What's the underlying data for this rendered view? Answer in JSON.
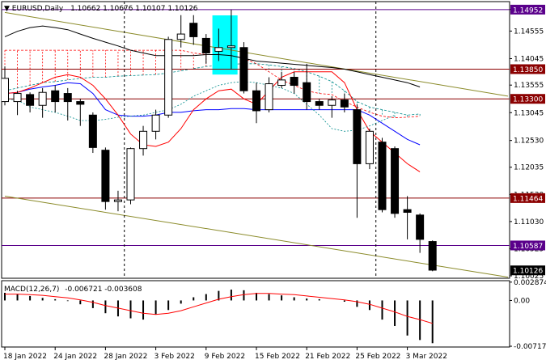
{
  "header": {
    "symbol": "EURUSD,Daily",
    "ohlc": "1.10662 1.10676 1.10107 1.10126"
  },
  "macd_header": {
    "label": "MACD(12,26,7)",
    "values": "-0.006721 -0.003608"
  },
  "colors": {
    "up_candle": "#ffffff",
    "down_candle": "#000000",
    "ma_red": "#ff0000",
    "ma_blue": "#0000ff",
    "ma_black": "#000000",
    "trend_olive": "#8b8b2a",
    "level_dark_red": "#8b0000",
    "level_purple": "#5a008b",
    "highlight_cyan": "#00ffff",
    "cloud_red": "#ff0000",
    "cloud_teal": "#008b8b",
    "current_price": "#000000",
    "macd_signal": "#ff0000"
  },
  "chart_data": [
    {
      "type": "candlestick",
      "symbol": "EURUSD",
      "timeframe": "Daily",
      "y_axis": {
        "ticks": [
          "1.14955",
          "1.14555",
          "1.14045",
          "1.13555",
          "1.13045",
          "1.12530",
          "1.12035",
          "1.11530",
          "1.11030",
          "1.10525",
          "1.10025"
        ],
        "ylim": [
          1.0998,
          1.151
        ]
      },
      "x_axis": {
        "ticks": [
          "18 Jan 2022",
          "24 Jan 2022",
          "28 Jan 2022",
          "3 Feb 2022",
          "9 Feb 2022",
          "15 Feb 2022",
          "21 Feb 2022",
          "25 Feb 2022",
          "3 Mar 2022"
        ],
        "tick_index": [
          0,
          4,
          8,
          12,
          16,
          20,
          24,
          28,
          32
        ]
      },
      "price_levels": [
        {
          "label": "1.14952",
          "value": 1.14952,
          "color": "#5a008b"
        },
        {
          "label": "1.13850",
          "value": 1.1385,
          "color": "#8b0000"
        },
        {
          "label": "1.13300",
          "value": 1.133,
          "color": "#8b0000"
        },
        {
          "label": "1.11464",
          "value": 1.11464,
          "color": "#8b0000"
        },
        {
          "label": "1.10587",
          "value": 1.10587,
          "color": "#5a008b"
        },
        {
          "label": "1.10126",
          "value": 1.10126,
          "color": "#000000"
        }
      ],
      "candles": [
        {
          "o": 1.1325,
          "h": 1.139,
          "l": 1.1318,
          "c": 1.1368
        },
        {
          "o": 1.1325,
          "h": 1.1345,
          "l": 1.13,
          "c": 1.134
        },
        {
          "o": 1.1338,
          "h": 1.1342,
          "l": 1.1305,
          "c": 1.1318
        },
        {
          "o": 1.1318,
          "h": 1.135,
          "l": 1.1295,
          "c": 1.1342
        },
        {
          "o": 1.1345,
          "h": 1.1355,
          "l": 1.1305,
          "c": 1.1325
        },
        {
          "o": 1.134,
          "h": 1.135,
          "l": 1.129,
          "c": 1.1325
        },
        {
          "o": 1.1325,
          "h": 1.133,
          "l": 1.128,
          "c": 1.132
        },
        {
          "o": 1.13,
          "h": 1.1305,
          "l": 1.123,
          "c": 1.124
        },
        {
          "o": 1.1235,
          "h": 1.124,
          "l": 1.1125,
          "c": 1.114
        },
        {
          "o": 1.114,
          "h": 1.116,
          "l": 1.1122,
          "c": 1.1143
        },
        {
          "o": 1.1143,
          "h": 1.124,
          "l": 1.1135,
          "c": 1.1238
        },
        {
          "o": 1.1238,
          "h": 1.128,
          "l": 1.1225,
          "c": 1.127
        },
        {
          "o": 1.127,
          "h": 1.131,
          "l": 1.1255,
          "c": 1.13
        },
        {
          "o": 1.13,
          "h": 1.1445,
          "l": 1.1295,
          "c": 1.144
        },
        {
          "o": 1.144,
          "h": 1.1485,
          "l": 1.1425,
          "c": 1.145
        },
        {
          "o": 1.147,
          "h": 1.1485,
          "l": 1.143,
          "c": 1.1445
        },
        {
          "o": 1.1442,
          "h": 1.145,
          "l": 1.1395,
          "c": 1.1415
        },
        {
          "o": 1.1418,
          "h": 1.146,
          "l": 1.14,
          "c": 1.1425
        },
        {
          "o": 1.1425,
          "h": 1.1495,
          "l": 1.1385,
          "c": 1.1428
        },
        {
          "o": 1.1425,
          "h": 1.1435,
          "l": 1.134,
          "c": 1.1345
        },
        {
          "o": 1.1345,
          "h": 1.136,
          "l": 1.1285,
          "c": 1.1308
        },
        {
          "o": 1.131,
          "h": 1.137,
          "l": 1.1305,
          "c": 1.1358
        },
        {
          "o": 1.1355,
          "h": 1.138,
          "l": 1.135,
          "c": 1.1365
        },
        {
          "o": 1.137,
          "h": 1.138,
          "l": 1.134,
          "c": 1.1355
        },
        {
          "o": 1.136,
          "h": 1.1395,
          "l": 1.131,
          "c": 1.1325
        },
        {
          "o": 1.1325,
          "h": 1.133,
          "l": 1.131,
          "c": 1.1318
        },
        {
          "o": 1.1318,
          "h": 1.1335,
          "l": 1.1295,
          "c": 1.1328
        },
        {
          "o": 1.1328,
          "h": 1.134,
          "l": 1.1305,
          "c": 1.1315
        },
        {
          "o": 1.131,
          "h": 1.132,
          "l": 1.111,
          "c": 1.121
        },
        {
          "o": 1.121,
          "h": 1.1275,
          "l": 1.12,
          "c": 1.127
        },
        {
          "o": 1.125,
          "h": 1.1258,
          "l": 1.112,
          "c": 1.1125
        },
        {
          "o": 1.1238,
          "h": 1.1242,
          "l": 1.111,
          "c": 1.1118
        },
        {
          "o": 1.1125,
          "h": 1.115,
          "l": 1.107,
          "c": 1.112
        },
        {
          "o": 1.1115,
          "h": 1.1118,
          "l": 1.1045,
          "c": 1.107
        },
        {
          "o": 1.1066,
          "h": 1.1068,
          "l": 1.1011,
          "c": 1.1013
        }
      ],
      "ma_red": [
        1.134,
        1.1342,
        1.135,
        1.136,
        1.137,
        1.1375,
        1.137,
        1.1355,
        1.133,
        1.13,
        1.1265,
        1.1245,
        1.1242,
        1.125,
        1.1275,
        1.131,
        1.133,
        1.1345,
        1.1348,
        1.133,
        1.132,
        1.1345,
        1.137,
        1.138,
        1.138,
        1.138,
        1.138,
        1.136,
        1.131,
        1.127,
        1.125,
        1.123,
        1.121,
        1.1195
      ],
      "ma_blue": [
        1.134,
        1.1342,
        1.1348,
        1.1352,
        1.1355,
        1.136,
        1.1358,
        1.134,
        1.131,
        1.13,
        1.1298,
        1.1298,
        1.13,
        1.1305,
        1.1305,
        1.1308,
        1.131,
        1.131,
        1.1312,
        1.1312,
        1.131,
        1.131,
        1.131,
        1.131,
        1.131,
        1.131,
        1.131,
        1.131,
        1.131,
        1.13,
        1.1285,
        1.127,
        1.1255,
        1.1245
      ],
      "ma_black": [
        1.1445,
        1.1455,
        1.1462,
        1.1465,
        1.1462,
        1.1458,
        1.145,
        1.1442,
        1.1435,
        1.1428,
        1.142,
        1.1415,
        1.141,
        1.141,
        1.141,
        1.141,
        1.1412,
        1.1412,
        1.141,
        1.1405,
        1.14,
        1.1398,
        1.1396,
        1.1394,
        1.1392,
        1.139,
        1.1388,
        1.1385,
        1.138,
        1.1375,
        1.137,
        1.1365,
        1.136,
        1.1352
      ],
      "cloud_a": [
        1.1345,
        1.135,
        1.1355,
        1.136,
        1.1362,
        1.1365,
        1.1368,
        1.137,
        1.137,
        1.1372,
        1.1373,
        1.1374,
        1.1375,
        1.1378,
        1.1382,
        1.1386,
        1.139,
        1.1392,
        1.1394,
        1.1395,
        1.1395,
        1.1393,
        1.139,
        1.1386,
        1.138,
        1.1372,
        1.1362,
        1.1345,
        1.1325,
        1.1315,
        1.131,
        1.1305,
        1.13,
        1.1302
      ],
      "cloud_b": [
        1.142,
        1.142,
        1.142,
        1.142,
        1.142,
        1.142,
        1.142,
        1.142,
        1.142,
        1.142,
        1.142,
        1.142,
        1.142,
        1.142,
        1.142,
        1.1415,
        1.1412,
        1.1412,
        1.141,
        1.1405,
        1.1395,
        1.138,
        1.1365,
        1.1355,
        1.1345,
        1.134,
        1.1338,
        1.1325,
        1.1315,
        1.1305,
        1.1298,
        1.1295,
        1.1296,
        1.1298
      ],
      "chikou": [
        1.133,
        1.1328,
        1.1315,
        1.131,
        1.1305,
        1.1298,
        1.129,
        1.129,
        1.1292,
        1.1296,
        1.1298,
        1.13,
        1.1305,
        1.131,
        1.132,
        1.1335,
        1.1345,
        1.1355,
        1.136,
        1.1362,
        1.136,
        1.1355,
        1.135,
        1.134,
        1.132,
        1.13,
        1.1275,
        1.127,
        1.1272,
        1.128,
        1.129,
        1.13
      ],
      "trend_upper": {
        "start": {
          "i": 0,
          "p": 1.149
        },
        "end": {
          "i": 40,
          "p": 1.1335
        }
      },
      "trend_lower": {
        "start": {
          "i": 0,
          "p": 1.115
        },
        "end": {
          "i": 40,
          "p": 1.1
        }
      },
      "vertical_dashed_index": [
        9.5,
        29.5
      ],
      "highlight_index": [
        16.5,
        18.5
      ]
    },
    {
      "type": "bar",
      "name": "MACD(12,26,7)",
      "y_axis": {
        "ticks": [
          "0.002874",
          "0.00",
          "-0.007178"
        ],
        "ylim": [
          -0.0073,
          0.0031
        ]
      },
      "histogram": [
        0.0012,
        0.001,
        0.0007,
        0.0004,
        0.0002,
        -0.0001,
        -0.0006,
        -0.0012,
        -0.002,
        -0.0025,
        -0.0028,
        -0.003,
        -0.0022,
        -0.0015,
        -0.0005,
        0.0005,
        0.001,
        0.0015,
        0.0017,
        0.0016,
        0.0012,
        0.001,
        0.0008,
        0.0005,
        0.0003,
        0.0002,
        0.0,
        -0.0002,
        -0.001,
        -0.0015,
        -0.003,
        -0.004,
        -0.0055,
        -0.0062,
        -0.0067
      ],
      "signal": [
        0.001,
        0.001,
        0.0009,
        0.0008,
        0.0006,
        0.0004,
        0.0001,
        -0.0003,
        -0.0008,
        -0.0012,
        -0.0016,
        -0.002,
        -0.0022,
        -0.002,
        -0.0016,
        -0.001,
        -0.0004,
        0.0002,
        0.0006,
        0.0009,
        0.0011,
        0.0011,
        0.001,
        0.0009,
        0.0007,
        0.0005,
        0.0003,
        0.0001,
        -0.0002,
        -0.0006,
        -0.0012,
        -0.0018,
        -0.0025,
        -0.003,
        -0.0036
      ]
    }
  ]
}
